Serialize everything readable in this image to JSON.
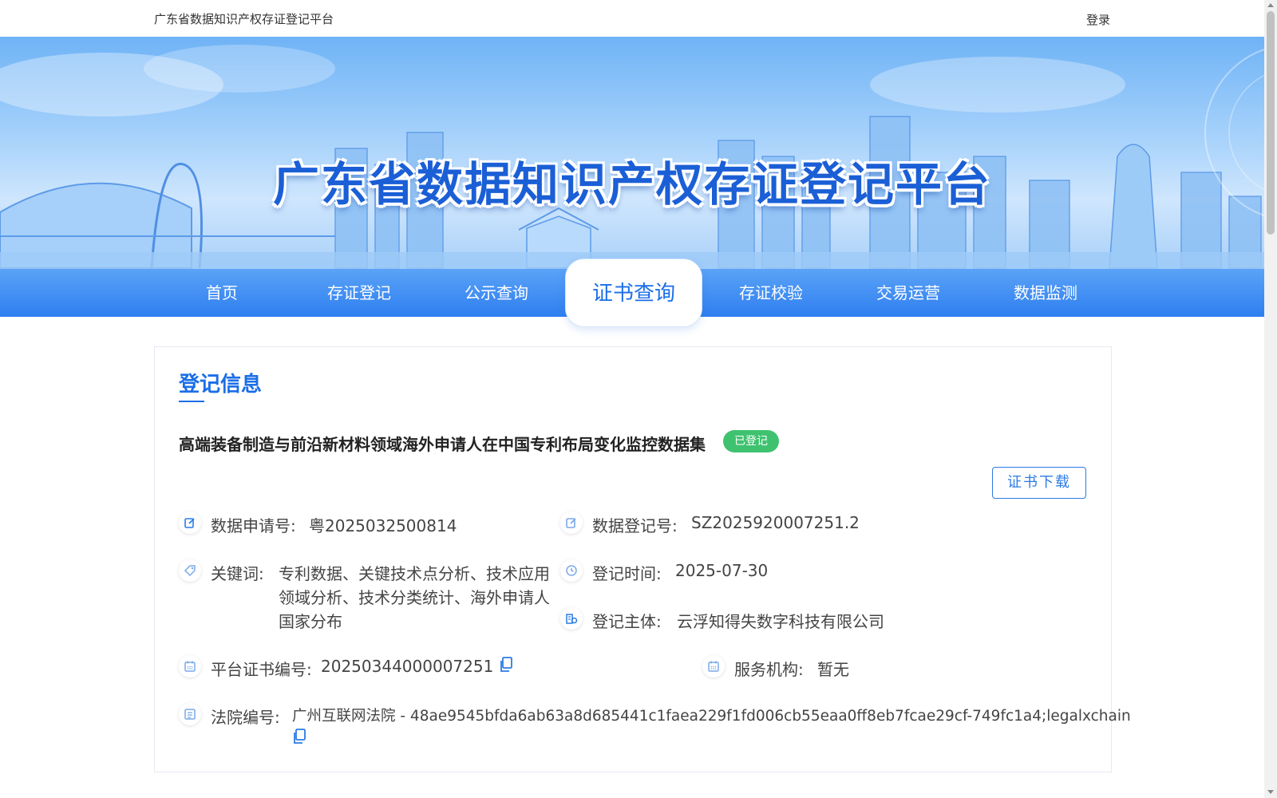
{
  "topbar": {
    "site_name": "广东省数据知识产权存证登记平台",
    "login_label": "登录"
  },
  "banner": {
    "title": "广东省数据知识产权存证登记平台"
  },
  "nav": {
    "items": [
      {
        "label": "首页"
      },
      {
        "label": "存证登记"
      },
      {
        "label": "公示查询"
      },
      {
        "label": "证书查询",
        "active": true
      },
      {
        "label": "存证校验"
      },
      {
        "label": "交易运营"
      },
      {
        "label": "数据监测"
      }
    ]
  },
  "card": {
    "section_title": "登记信息",
    "dataset_title": "高端装备制造与前沿新材料领域海外申请人在中国专利布局变化监控数据集",
    "status": "已登记",
    "download_label": "证书下载",
    "fields": {
      "application_no_label": "数据申请号:",
      "application_no": "粤2025032500814",
      "registration_no_label": "数据登记号:",
      "registration_no": "SZ2025920007251.2",
      "keywords_label": "关键词:",
      "keywords_line1": "专利数据、关键技术点分析、技术应用",
      "keywords_line2": "领域分析、技术分类统计、海外申请人",
      "keywords_line3": "国家分布",
      "reg_time_label": "登记时间:",
      "reg_time": "2025-07-30",
      "reg_subject_label": "登记主体:",
      "reg_subject": "云浮知得失数字科技有限公司",
      "cert_no_label": "平台证书编号:",
      "cert_no": "20250344000007251",
      "service_org_label": "服务机构:",
      "service_org": "暂无",
      "court_no_label": "法院编号:",
      "court_no": "广州互联网法院 - 48ae9545bfda6ab63a8d685441c1faea229f1fd006cb55eaa0ff8eb7fcae29cf-749fc1a4;legalxchain"
    }
  },
  "colors": {
    "brand_blue": "#1b6ee8",
    "badge_green": "#3fc26f"
  }
}
